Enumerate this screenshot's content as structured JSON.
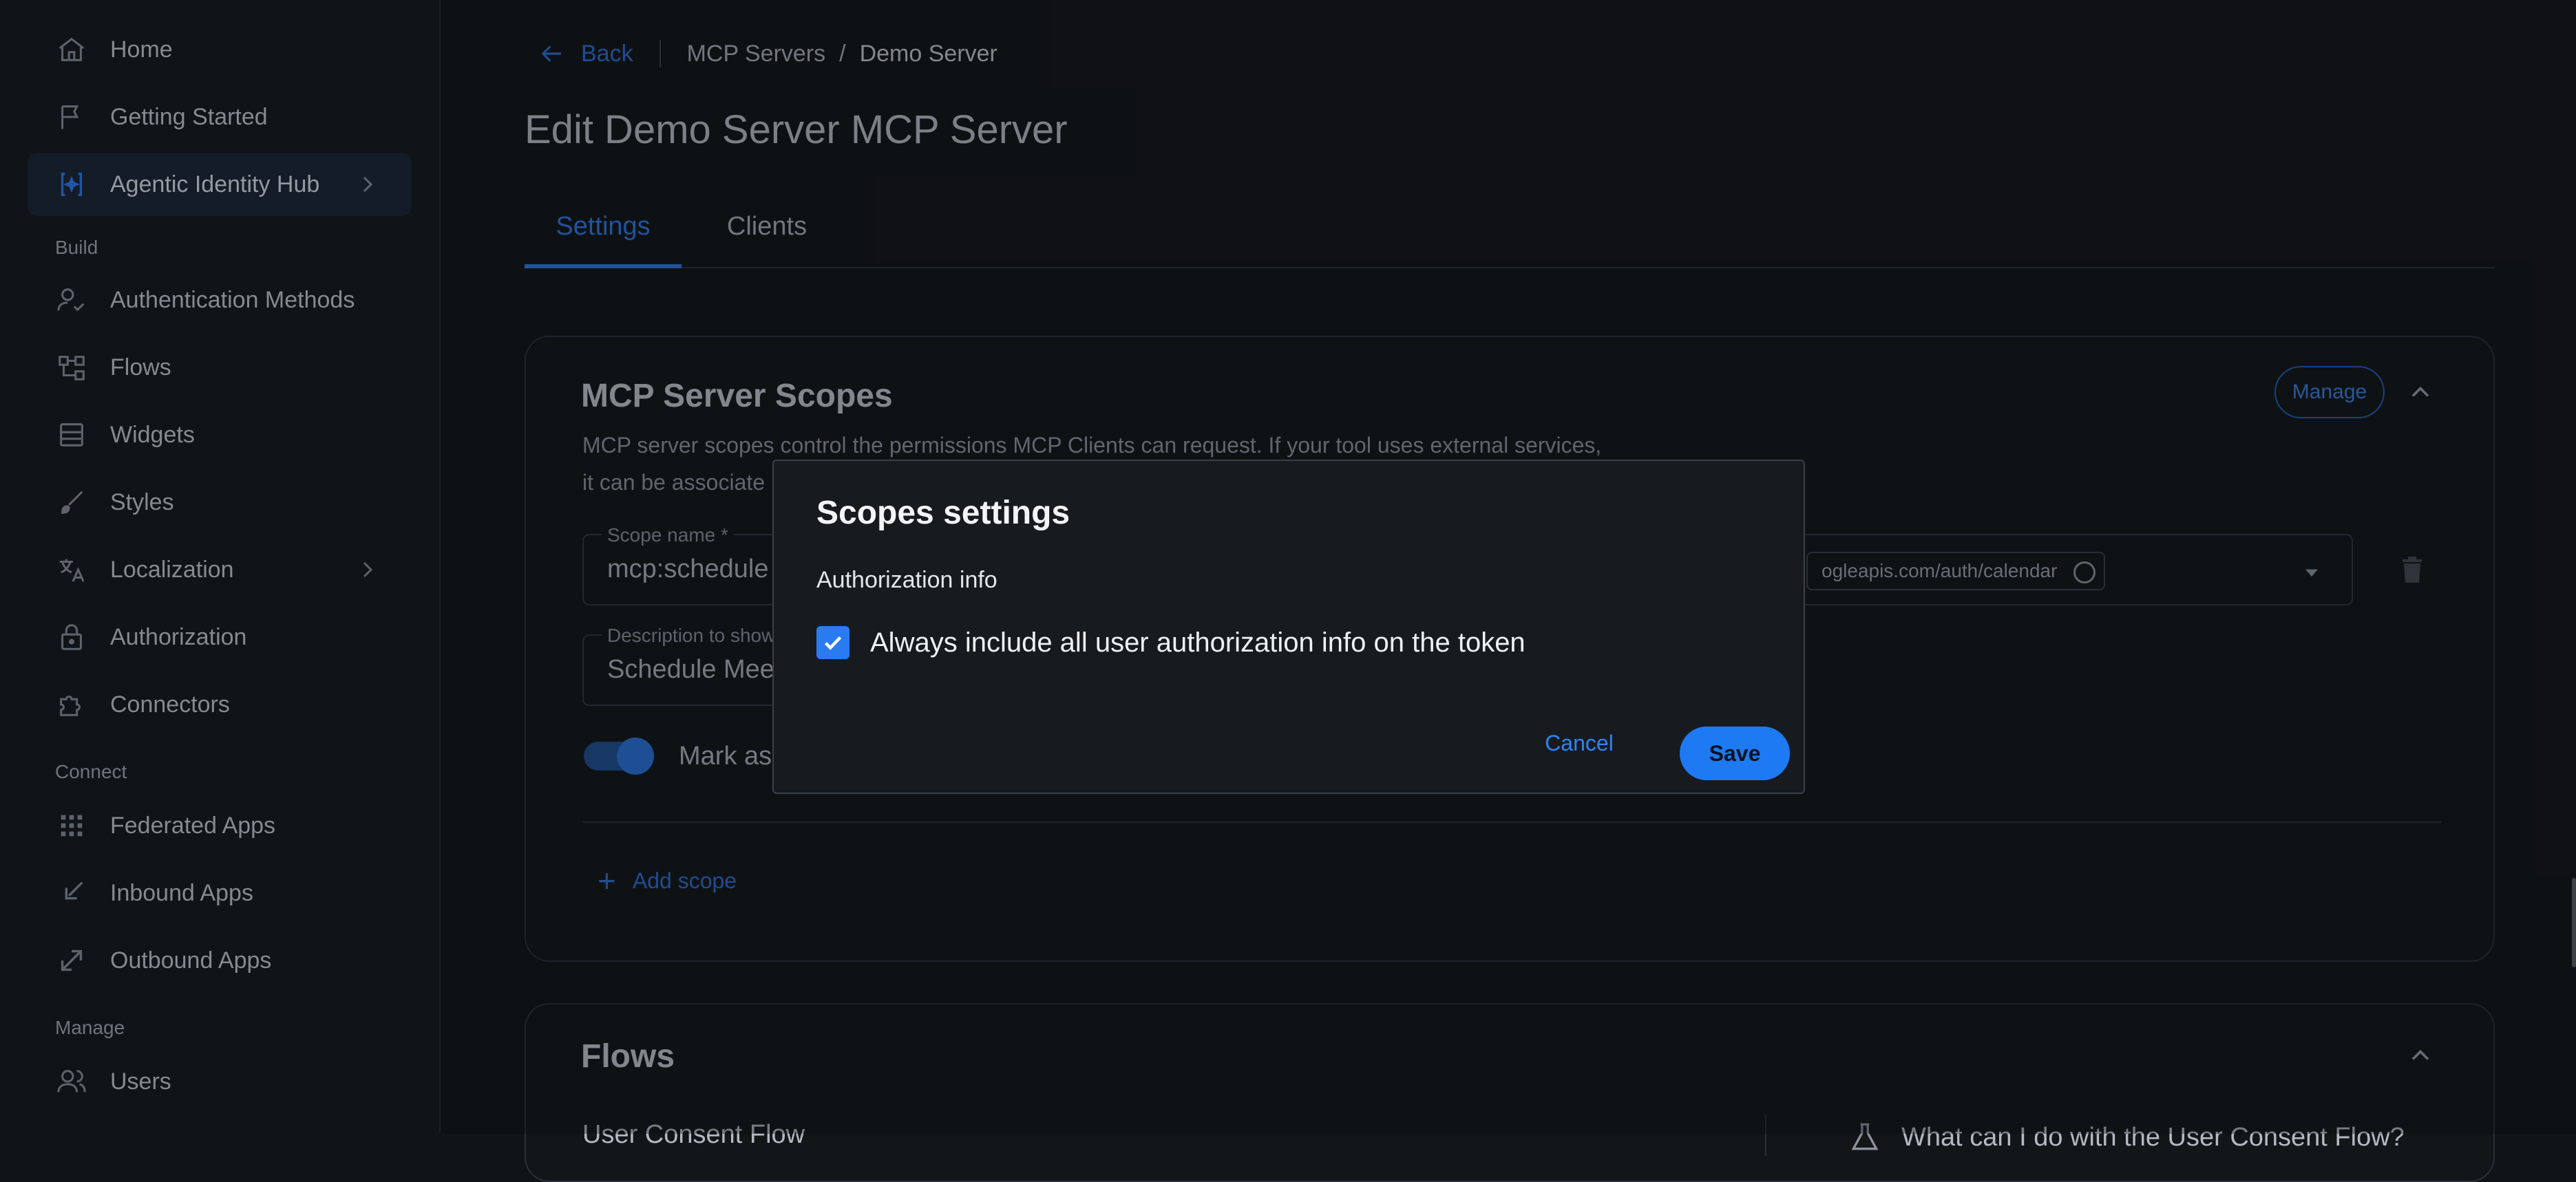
{
  "sidebar": {
    "items": [
      {
        "label": "Home",
        "icon": "home-icon"
      },
      {
        "label": "Getting Started",
        "icon": "flag-icon"
      },
      {
        "label": "Agentic Identity Hub",
        "icon": "agentic-hub-icon",
        "active": true
      },
      {
        "label": "Authentication Methods",
        "icon": "user-check-icon"
      },
      {
        "label": "Flows",
        "icon": "flows-icon"
      },
      {
        "label": "Widgets",
        "icon": "widgets-icon"
      },
      {
        "label": "Styles",
        "icon": "brush-icon"
      },
      {
        "label": "Localization",
        "icon": "translate-icon"
      },
      {
        "label": "Authorization",
        "icon": "lock-icon"
      },
      {
        "label": "Connectors",
        "icon": "puzzle-icon"
      },
      {
        "label": "Federated Apps",
        "icon": "grid-icon"
      },
      {
        "label": "Inbound Apps",
        "icon": "inbound-icon"
      },
      {
        "label": "Outbound Apps",
        "icon": "outbound-icon"
      },
      {
        "label": "Users",
        "icon": "users-icon"
      }
    ],
    "sections": {
      "build": "Build",
      "connect": "Connect",
      "manage": "Manage"
    }
  },
  "breadcrumb": {
    "back": "Back",
    "parent": "MCP Servers",
    "separator": "/",
    "current": "Demo Server"
  },
  "page_title": "Edit Demo Server MCP Server",
  "tabs": [
    {
      "label": "Settings",
      "selected": true
    },
    {
      "label": "Clients",
      "selected": false
    }
  ],
  "scopes_card": {
    "title": "MCP Server Scopes",
    "manage_label": "Manage",
    "description_line1": "MCP server scopes control the permissions MCP Clients can request. If your tool uses external services,",
    "description_line2": "it can be associate",
    "scope_name_label": "Scope name *",
    "scope_name_value": "mcp:schedule",
    "description_label": "Description to show",
    "description_value": "Schedule Mee",
    "chip_value": "ogleapis.com/auth/calendar",
    "toggle_label": "Mark as m",
    "add_scope_label": "Add scope"
  },
  "flows_card": {
    "title": "Flows",
    "subtitle": "User Consent Flow",
    "help_text": "What can I do with the User Consent Flow?"
  },
  "modal": {
    "title": "Scopes settings",
    "section": "Authorization info",
    "checkbox_label": "Always include all user authorization info on the token",
    "checkbox_checked": true,
    "cancel_label": "Cancel",
    "save_label": "Save"
  },
  "colors": {
    "accent": "#2a7bf0",
    "background": "#111417",
    "sidebar_active": "#1a2535"
  }
}
